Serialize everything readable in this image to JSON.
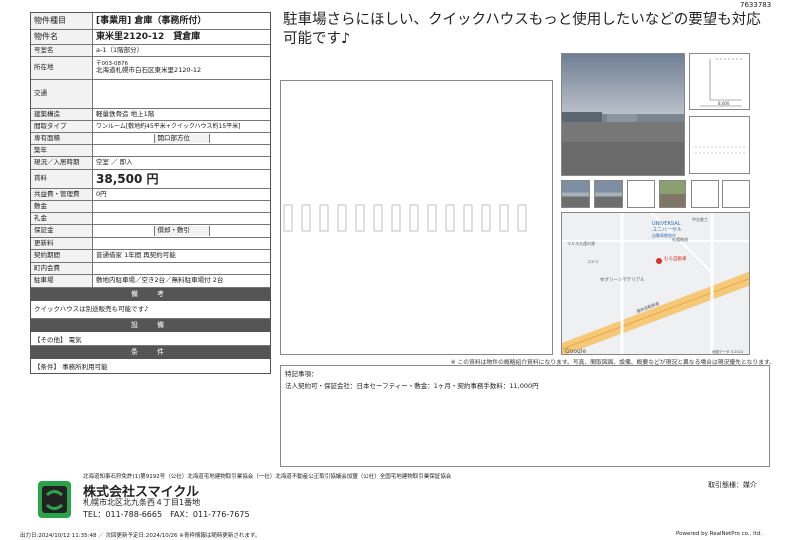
{
  "header": {
    "ref_code": "7633783"
  },
  "catch_copy": "駐車場さらにほしい、クイックハウスもっと使用したいなどの要望も対応可能です♪",
  "property": {
    "type_label": "物件種目",
    "type_value": "[事業用] 倉庫（事務所付）",
    "name_label": "物件名",
    "name_value": "東米里2120-12　貸倉庫",
    "room_label": "号室名",
    "room_value": "a-1（1階部分）",
    "address_label": "所在地",
    "zip": "〒003-0876",
    "address_value": "北海道札幌市白石区東米里2120-12",
    "transport_label": "交通",
    "transport_value": "",
    "structure_label": "建築構造",
    "structure_value": "軽量鉄骨造 地上1階",
    "layout_label": "間取タイプ",
    "layout_value": "ワンルーム[敷地約45平米+クイックハウス約15平米]",
    "area_label": "専有面積",
    "area_value": "",
    "facing_label": "開口部方位",
    "facing_value": "",
    "age_label": "築年",
    "age_value": "",
    "status_label": "現況／入居時期",
    "status_value": "空室 ／ 即入",
    "rent_label": "賃料",
    "rent_value": "38,500 円",
    "fee_label": "共益費・管理費",
    "fee_value": "0円",
    "deposit_label": "敷金",
    "deposit_value": "",
    "keymoney_label": "礼金",
    "keymoney_value": "",
    "guarantee_label": "保証金",
    "guarantee_value": "",
    "amort_label": "償却・敷引",
    "amort_value": "",
    "renewal_label": "更新料",
    "renewal_value": "",
    "contract_label": "契約期間",
    "contract_value": "普通借家 1年間 再契約可能",
    "town_label": "町内会費",
    "town_value": "",
    "parking_label": "駐車場",
    "parking_value": "敷地内駐車場／空き2台／無料駐車場付 2台"
  },
  "sections": {
    "remarks_title": "備　考",
    "remarks_text": "クイックハウスは別途販売も可能です♪",
    "facility_title": "設　備",
    "facility_text": "【その他】 電気",
    "conditions_title": "条　件",
    "conditions_text": "【条件】 事務所利用可能"
  },
  "disclaimer": "※ この資料は物件の概略紹介資料になります。写真、間取図面、設備、概要などが現況と異なる場合は現況優先となります。",
  "special": {
    "title": "特記事項：",
    "text": "法人契約可・保証会社：日本セーフティー・敷金：1ヶ月・契約事務手数料：11,000円"
  },
  "floor_plan": {
    "dimension": "8,000"
  },
  "map": {
    "labels": [
      "UNIVERSAL",
      "ユニバーサル",
      "自動車教習所",
      "中谷産工",
      "札幌物流",
      "マルス久遠の源",
      "むら自動車",
      "ゆグリーンマテリアル",
      "コメリ",
      "道央自動車道",
      "Google",
      "地図データ ©2024"
    ]
  },
  "legal_line": "北海道知事石狩免許(1)第9192号（公社）北海道宅地建物取引業協会（一社）北海道不動産公正取引協議会加盟（公社）全国宅地建物取引業保証協会",
  "company": {
    "name": "株式会社スマイクル",
    "address": "札幌市北区北九条西４丁目1番地",
    "phone": "TEL：011-788-6665　FAX：011-776-7675",
    "deal_type": "取引態様：媒介"
  },
  "footer": {
    "left": "出力日:2024/10/12 11:35:48 ／ 次回更新予定日:2024/10/26 ※青枠情報は随時更新されます。",
    "right": "Powered by RealNetPro co., ltd."
  },
  "colors": {
    "logo_green": "#2aa34a",
    "logo_dark": "#222222",
    "section_bg": "#555555"
  }
}
